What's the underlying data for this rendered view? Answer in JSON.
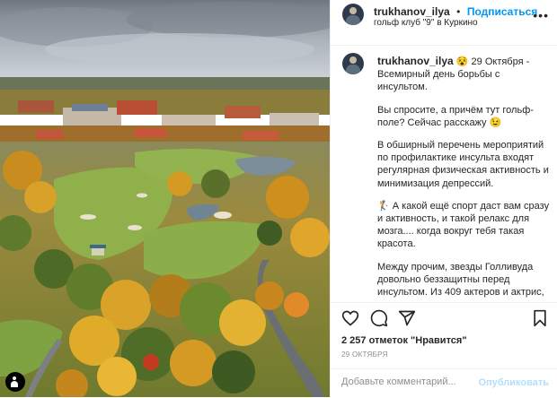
{
  "post": {
    "username": "trukhanov_ilya",
    "follow_label": "Подписаться",
    "separator": "•",
    "location": "гольф клуб \"9\" в Куркино",
    "more_label": "•••"
  },
  "caption": {
    "username": "trukhanov_ilya",
    "emoji": "😵",
    "date": "29 Октября",
    "title_line": "- Всемирный день борьбы с инсультом.",
    "paragraphs": [
      "Вы спросите, а причём тут гольф-поле? Сейчас расскажу 😉",
      "В обширный перечень мероприятий по профилактике инсульта входят регулярная физическая активность и минимизация депрессий.",
      "🏌 А какой ещё спорт даст вам сразу и активность, и такой релакс для мозга.... когда вокруг тебя такая красота.",
      "Между прочим, звезды Голливуда довольно беззащитны перед инсультом. Из 409 актеров и актрис,"
    ]
  },
  "actions": {
    "icons": [
      "heart-icon",
      "comment-icon",
      "share-icon",
      "bookmark-icon"
    ]
  },
  "likes_text": "2 257 отметок \"Нравится\"",
  "post_date": "29 ОКТЯБРЯ",
  "comment": {
    "placeholder": "Добавьте комментарий...",
    "publish_label": "Опубликовать"
  },
  "colors": {
    "accent": "#0095f6",
    "publish_disabled": "#b2dffc",
    "muted": "#8e8e8e",
    "text": "#262626"
  }
}
